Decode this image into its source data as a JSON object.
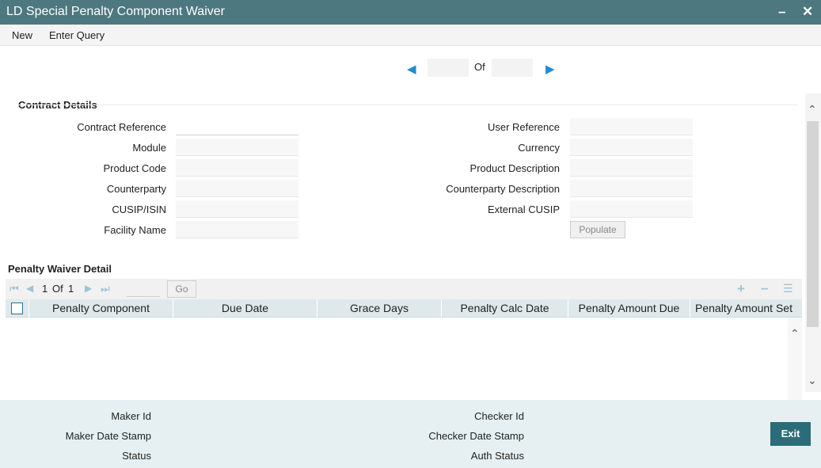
{
  "window": {
    "title": "LD Special Penalty Component Waiver"
  },
  "menu": {
    "new": "New",
    "enter_query": "Enter Query"
  },
  "navigation": {
    "of_label": "Of"
  },
  "contract_details": {
    "title": "Contract Details",
    "contract_reference": "Contract Reference",
    "module": "Module",
    "product_code": "Product Code",
    "counterparty": "Counterparty",
    "cusip_isin": "CUSIP/ISIN",
    "facility_name": "Facility Name",
    "user_reference": "User Reference",
    "currency": "Currency",
    "product_description": "Product Description",
    "counterparty_description": "Counterparty Description",
    "external_cusip": "External CUSIP",
    "populate_button": "Populate"
  },
  "penalty_waiver": {
    "title": "Penalty Waiver Detail",
    "pager": {
      "page": "1",
      "of": "Of",
      "total": "1",
      "go": "Go"
    },
    "columns": [
      "Penalty Component",
      "Due Date",
      "Grace Days",
      "Penalty Calc Date",
      "Penalty Amount Due",
      "Penalty Amount Set"
    ]
  },
  "footer": {
    "maker_id": "Maker Id",
    "maker_date_stamp": "Maker Date Stamp",
    "status": "Status",
    "checker_id": "Checker Id",
    "checker_date_stamp": "Checker Date Stamp",
    "auth_status": "Auth Status",
    "exit": "Exit"
  },
  "colors": {
    "titlebar": "#4d7880",
    "footer": "#e6f0f2",
    "exit": "#2b6c78",
    "nav_arrow": "#1a8fd2"
  }
}
